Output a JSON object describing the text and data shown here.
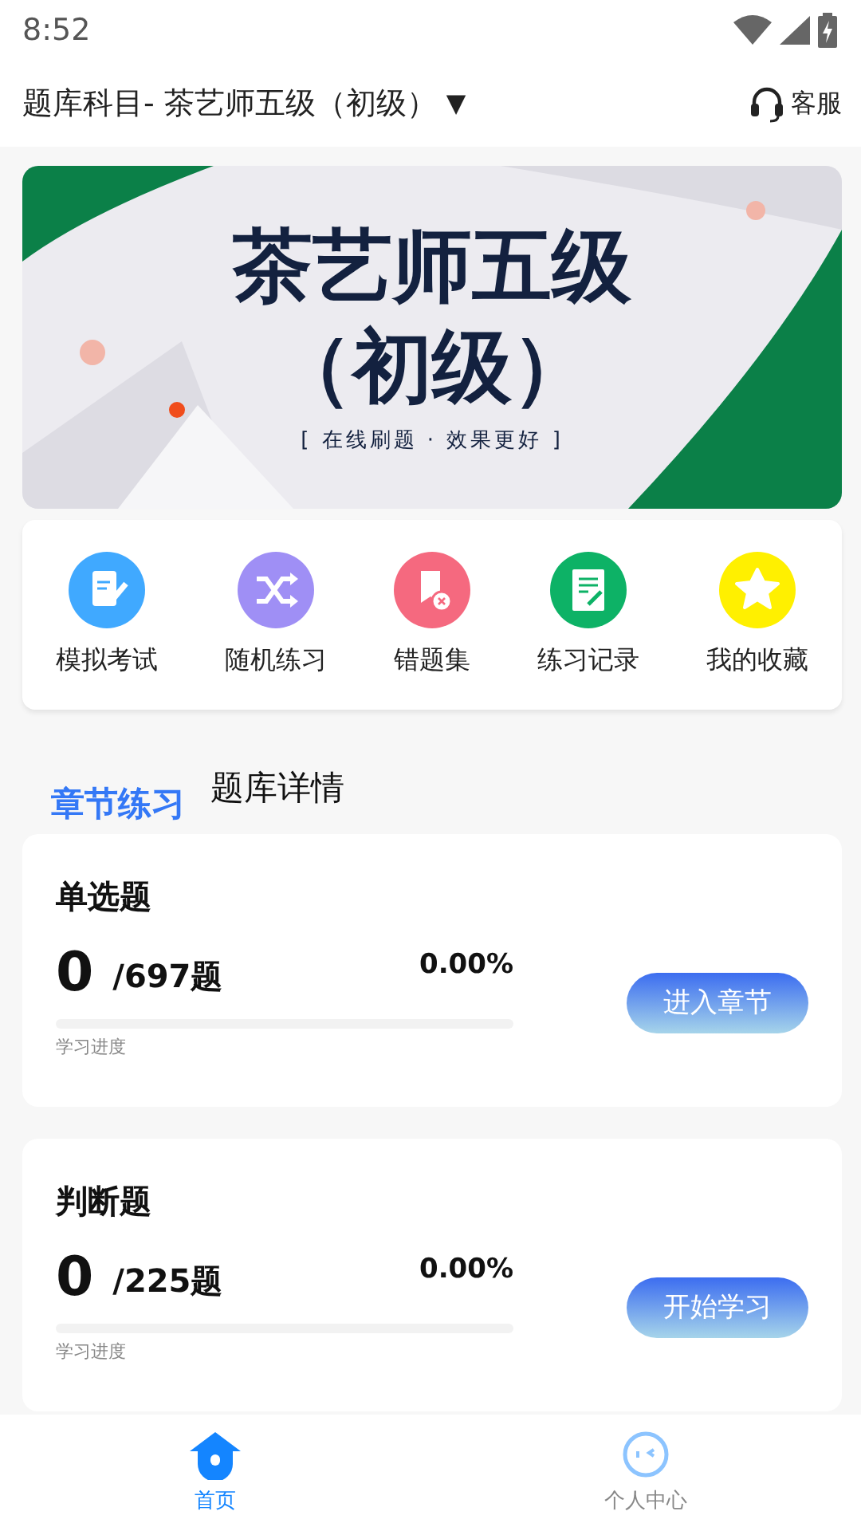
{
  "status_bar": {
    "time": "8:52"
  },
  "header": {
    "title": "题库科目- 茶艺师五级（初级）",
    "dropdown": "▼",
    "service": "客服"
  },
  "banner": {
    "title_line_1": "茶艺师五级",
    "title_line_2": "（初级）",
    "slogan": "[ 在线刷题 · 效果更好 ]"
  },
  "shortcuts": [
    {
      "label": "模拟考试",
      "kind": "exam",
      "color": "#40a9ff"
    },
    {
      "label": "随机练习",
      "kind": "shuffle",
      "color": "#9f8ff5"
    },
    {
      "label": "错题集",
      "kind": "wrong",
      "color": "#f5697f"
    },
    {
      "label": "练习记录",
      "kind": "record",
      "color": "#0db266"
    },
    {
      "label": "我的收藏",
      "kind": "favorite",
      "color": "#fff000"
    }
  ],
  "tabs": [
    {
      "label": "章节练习",
      "selected": true
    },
    {
      "label": "题库详情",
      "selected": false
    }
  ],
  "sections": [
    {
      "title": "单选题",
      "done": "0",
      "total": "/697题",
      "percent": "0.00%",
      "level": 0,
      "progress_label": "学习进度",
      "button": "进入章节"
    },
    {
      "title": "判断题",
      "done": "0",
      "total": "/225题",
      "percent": "0.00%",
      "level": 0,
      "progress_label": "学习进度",
      "button": "开始学习"
    }
  ],
  "bottom_nav": [
    {
      "label": "首页",
      "kind": "home",
      "selected": true
    },
    {
      "label": "个人中心",
      "kind": "profile",
      "selected": false
    }
  ]
}
